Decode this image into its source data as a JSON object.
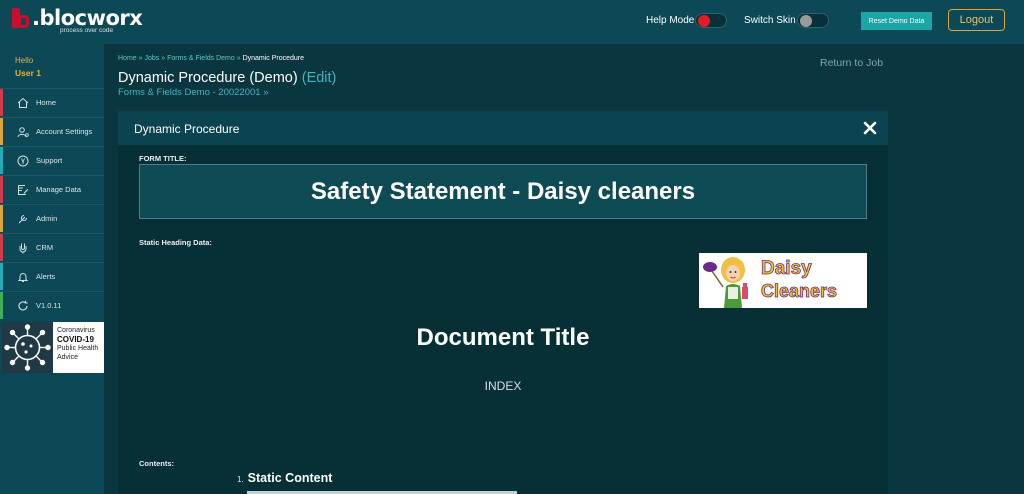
{
  "topbar": {
    "logo_text": ".blocworx",
    "logo_tagline": "process over code",
    "help_mode_label": "Help Mode",
    "switch_skin_label": "Switch Skin",
    "reset_button": "Reset Demo Data",
    "logout_button": "Logout",
    "help_mode_color": "#e31b23",
    "switch_skin_color": "#9a9a9a"
  },
  "sidebar": {
    "hello": "Hello",
    "user": "User 1",
    "items": [
      {
        "label": "Home",
        "icon": "home-icon",
        "color": "#d23b4b"
      },
      {
        "label": "Account Settings",
        "icon": "user-settings-icon",
        "color": "#d8a53a"
      },
      {
        "label": "Support",
        "icon": "support-icon",
        "color": "#25a9b8"
      },
      {
        "label": "Manage Data",
        "icon": "edit-data-icon",
        "color": "#d23b4b"
      },
      {
        "label": "Admin",
        "icon": "admin-icon",
        "color": "#d8a53a"
      },
      {
        "label": "CRM",
        "icon": "crm-icon",
        "color": "#d23b4b"
      },
      {
        "label": "Alerts",
        "icon": "alerts-icon",
        "color": "#25a9b8"
      },
      {
        "label": "V1.0.11",
        "icon": "refresh-icon",
        "color": "#3fae5a"
      }
    ],
    "covid": {
      "line1": "Coronavirus",
      "line2": "COVID-19",
      "line3": "Public Health",
      "line4": "Advice"
    }
  },
  "header": {
    "breadcrumb": {
      "home": "Home",
      "sep": " » ",
      "jobs": "Jobs",
      "forms": "Forms & Fields Demo",
      "current": "Dynamic Procedure"
    },
    "title": "Dynamic Procedure (Demo)",
    "edit": "(Edit)",
    "sub_link": "Forms & Fields Demo - 20022001 »",
    "return_link": "Return to Job"
  },
  "modal": {
    "title": "Dynamic Procedure",
    "form_title_label": "FORM TITLE:",
    "form_title_value": "Safety Statement - Daisy cleaners",
    "static_heading_label": "Static Heading Data:",
    "logo_line1": "Daisy",
    "logo_line2": "Cleaners",
    "document_title": "Document Title",
    "index": "INDEX",
    "contents_label": "Contents:",
    "toc_number": "1.",
    "toc_item": "Static Content"
  }
}
